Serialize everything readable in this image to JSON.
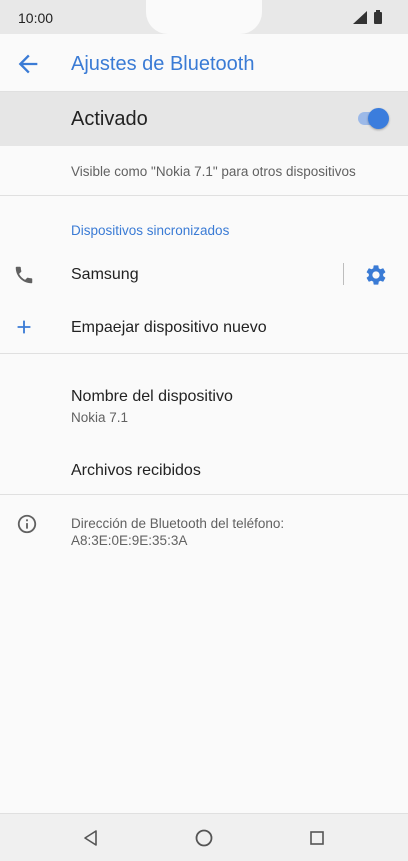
{
  "status_bar": {
    "time": "10:00"
  },
  "toolbar": {
    "title": "Ajustes de Bluetooth"
  },
  "master": {
    "label": "Activado",
    "enabled": true
  },
  "visible": {
    "text": "Visible como \"Nokia 7.1\" para otros dispositivos"
  },
  "paired_section": {
    "header": "Dispositivos sincronizados",
    "devices": [
      {
        "name": "Samsung"
      }
    ]
  },
  "pair_new": {
    "label": "Empaejar dispositivo nuevo"
  },
  "device_name": {
    "title": "Nombre del dispositivo",
    "value": "Nokia 7.1"
  },
  "received_files": {
    "label": "Archivos recibidos"
  },
  "address_info": {
    "text": "Dirección de Bluetooth del teléfono: A8:3E:0E:9E:35:3A"
  },
  "colors": {
    "accent": "#3a7bd5",
    "toggle_thumb": "#3b7ddd",
    "master_bg": "#e6e6e6"
  },
  "icons": [
    "back-arrow-icon",
    "phone-icon",
    "gear-icon",
    "plus-icon",
    "info-icon",
    "signal-icon",
    "battery-icon",
    "nav-back-icon",
    "nav-home-icon",
    "nav-recents-icon"
  ]
}
